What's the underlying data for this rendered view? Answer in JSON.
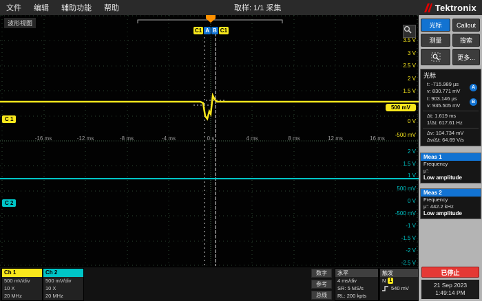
{
  "colors": {
    "ch1": "#f8e71c",
    "ch2": "#00c5c7",
    "accent_blue": "#1273d2",
    "stop_red": "#e53935",
    "tek_red": "#e00000"
  },
  "menu": {
    "items": [
      "文件",
      "编辑",
      "辅助功能",
      "帮助"
    ],
    "acquisition": "取样: 1/1 采集",
    "logo": "Tektronix"
  },
  "waveform": {
    "view_label": "波形视图",
    "badges": {
      "c1_left": "C1",
      "a": "A",
      "b": "B",
      "c1_right": "C1"
    },
    "ch1_badge": "C 1",
    "ch2_badge": "C 2",
    "level_badge": "500 mV",
    "y_ch1": [
      "3.5 V",
      "3 V",
      "2.5 V",
      "2 V",
      "1.5 V"
    ],
    "y_ch1_low": [
      "0 V",
      "-500 mV"
    ],
    "y_ch2": [
      "2 V",
      "1.5 V",
      "1 V",
      "500 mV",
      "0 V",
      "-500 mV",
      "-1 V",
      "-1.5 V",
      "-2 V",
      "-2.5 V"
    ],
    "x_labels": [
      "-16 ms",
      "-12 ms",
      "-8 ms",
      "-4 ms",
      "0 s",
      "4 ms",
      "8 ms",
      "12 ms",
      "16 ms"
    ]
  },
  "panel": {
    "cursor_btn": "光标",
    "callout_btn": "Callout",
    "measure_btn": "测量",
    "search_btn": "搜索",
    "more_btn": "更多...",
    "cursors": {
      "title": "光标",
      "a_badge": "A",
      "a_t": "t: -715.989 µs",
      "a_v": "v: 830.771 mV",
      "b_badge": "B",
      "b_t": "t: 903.146 µs",
      "b_v": "v: 935.505 mV",
      "dt": "Δt: 1.619 ms",
      "inv_dt": "1/Δt: 617.61 Hz",
      "dv": "Δv: 104.734 mV",
      "dvdt": "Δv/Δt: 64.69 V/s"
    },
    "meas1": {
      "title": "Meas 1",
      "type": "Frequency",
      "mean": "µ':",
      "status": "Low amplitude"
    },
    "meas2": {
      "title": "Meas 2",
      "type": "Frequency",
      "mean": "µ': 442.2 kHz",
      "status": "Low amplitude"
    }
  },
  "bottom": {
    "ch1": {
      "name": "Ch 1",
      "scale": "500 mV/div",
      "probe": "10 X",
      "bandwidth": "20 MHz"
    },
    "ch2": {
      "name": "Ch 2",
      "scale": "500 mV/div",
      "probe": "10 X",
      "bandwidth": "20 MHz"
    },
    "digital_btn": "数字",
    "ref_btn": "参考",
    "bus_btn": "总线",
    "horizontal": {
      "title": "水平",
      "scale": "4 ms/div",
      "sample_rate": "SR: 5 MS/s",
      "record_length": "RL: 200 kpts"
    },
    "trigger": {
      "title": "触发",
      "mode": "N",
      "source": "1",
      "level": "540 mV"
    },
    "run_state": "已停止",
    "date": "21 Sep 2023",
    "time": "1:49:14 PM"
  }
}
